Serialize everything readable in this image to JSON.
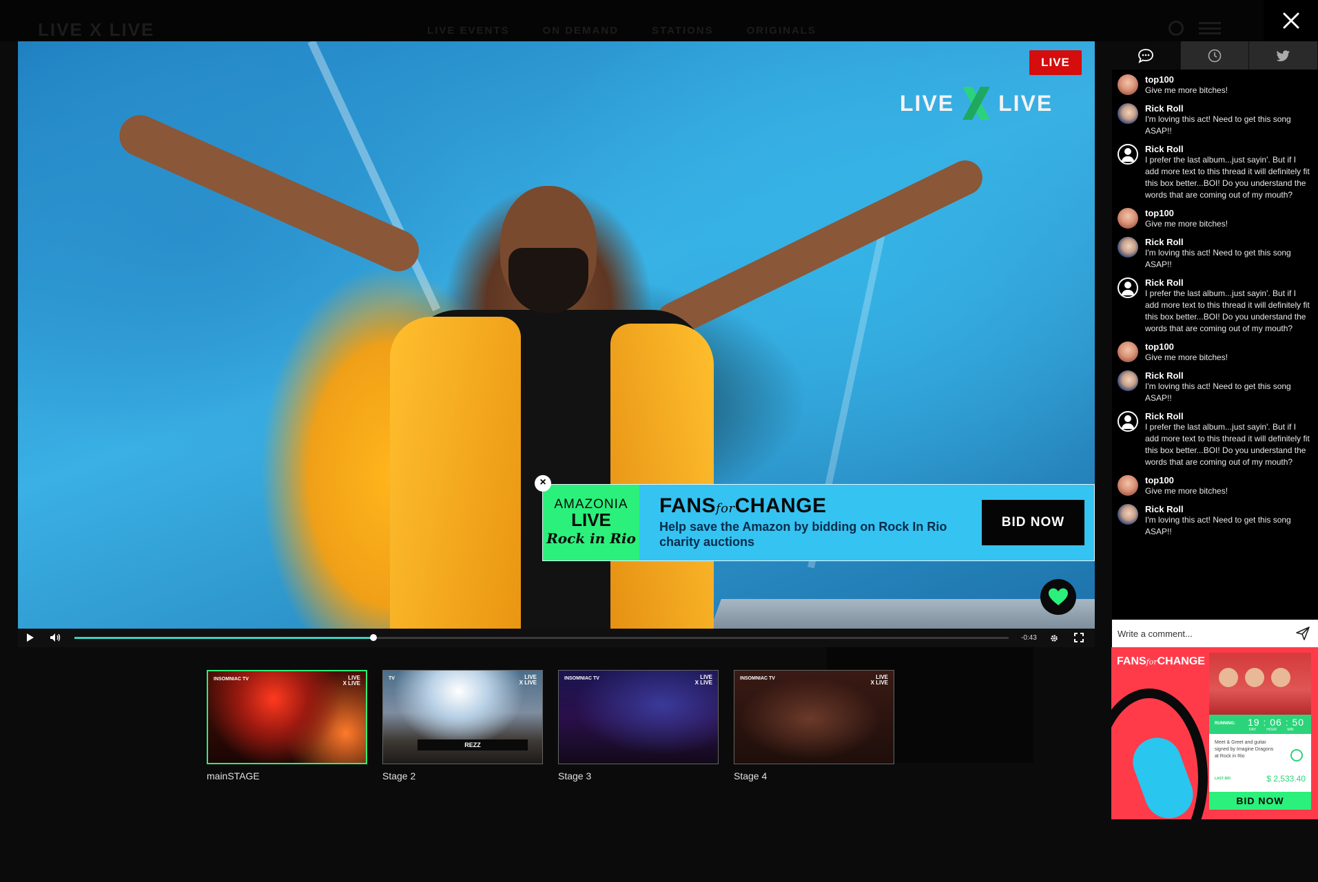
{
  "nav": {
    "logo": "LIVE X LIVE",
    "links": [
      "LIVE EVENTS",
      "ON DEMAND",
      "STATIONS",
      "ORIGINALS"
    ],
    "close_icon": "close-icon",
    "search_icon": "search-icon",
    "menu_icon": "hamburger-menu-icon"
  },
  "player": {
    "live_badge": "LIVE",
    "logo_left": "LIVE",
    "logo_right": "LIVE",
    "progress": 0.32,
    "time_remaining": "-0:43",
    "colors": {
      "accent": "#2bf07b",
      "live": "#d50d0d",
      "progress": "#3ad3c2"
    }
  },
  "ad_banner": {
    "logo_line1": "AMAZONIA",
    "logo_line2": "LIVE",
    "logo_line3": "Rock in Rio",
    "title_a": "FANS",
    "title_for": "for",
    "title_b": "CHANGE",
    "description": "Help save the Amazon by bidding on Rock In Rio charity auctions",
    "bid_label": "BID NOW",
    "close_label": "×",
    "bg_color": "#35c3f2"
  },
  "thumbnails": [
    {
      "label": "mainSTAGE",
      "badge": "INSOMNIAC TV",
      "active": true
    },
    {
      "label": "Stage 2",
      "badge": "TV",
      "overlay": "REZZ",
      "active": false
    },
    {
      "label": "Stage 3",
      "badge": "INSOMNIAC TV",
      "active": false
    },
    {
      "label": "Stage 4",
      "badge": "INSOMNIAC TV",
      "active": false
    }
  ],
  "chat": {
    "tabs": [
      "chat-bubble-icon",
      "clock-icon",
      "twitter-icon"
    ],
    "messages": [
      {
        "user": "top100",
        "text": "Give me more bitches!",
        "avatar": "a"
      },
      {
        "user": "Rick Roll",
        "text": "I'm loving this act! Need to get this song ASAP!!",
        "avatar": "b"
      },
      {
        "user": "Rick Roll",
        "text": "I prefer the last album...just sayin'. But if I add more text to this thread it will definitely fit this box better...BOI! Do you understand the words that are coming out of my mouth?",
        "avatar": "c"
      },
      {
        "user": "top100",
        "text": "Give me more bitches!",
        "avatar": "a"
      },
      {
        "user": "Rick Roll",
        "text": "I'm loving this act! Need to get this song ASAP!!",
        "avatar": "b"
      },
      {
        "user": "Rick Roll",
        "text": "I prefer the last album...just sayin'. But if I add more text to this thread it will definitely fit this box better...BOI! Do you understand the words that are coming out of my mouth?",
        "avatar": "c"
      },
      {
        "user": "top100",
        "text": "Give me more bitches!",
        "avatar": "a"
      },
      {
        "user": "Rick Roll",
        "text": "I'm loving this act! Need to get this song ASAP!!",
        "avatar": "b"
      },
      {
        "user": "Rick Roll",
        "text": "I prefer the last album...just sayin'. But if I add more text to this thread it will definitely fit this box better...BOI! Do you understand the words that are coming out of my mouth?",
        "avatar": "c"
      },
      {
        "user": "top100",
        "text": "Give me more bitches!",
        "avatar": "a"
      },
      {
        "user": "Rick Roll",
        "text": "I'm loving this act! Need to get this song ASAP!!",
        "avatar": "b"
      }
    ],
    "comment_placeholder": "Write a comment..."
  },
  "side_ad": {
    "title_a": "FANS",
    "title_for": "for",
    "title_b": "CHANGE",
    "timer_label": "RUNNING:",
    "timer_value": "19 : 06 : 50",
    "timer_units": "DAY HOUR MIN",
    "text": "Meet & Greet and guitar signed by Imagine Dragons at Rock in Rio",
    "last_bid_label": "LAST BID",
    "last_bid_amount": "$ 2,533.40",
    "bid_label": "BID NOW"
  }
}
